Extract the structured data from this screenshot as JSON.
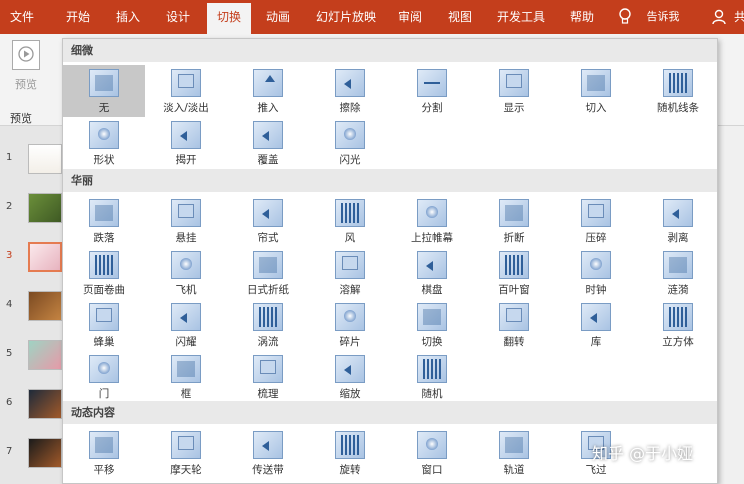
{
  "ribbon": {
    "tabs": [
      "文件",
      "开始",
      "插入",
      "设计",
      "切换",
      "动画",
      "幻灯片放映",
      "审阅",
      "视图",
      "开发工具",
      "帮助",
      "告诉我",
      "共"
    ],
    "active_tab": 4,
    "preview_label": "预览",
    "preview_group_label": "预览"
  },
  "slides": [
    "1",
    "2",
    "3",
    "4",
    "5",
    "6",
    "7"
  ],
  "selected_slide": 2,
  "gallery": {
    "sections": [
      {
        "title": "细微",
        "items": [
          "无",
          "淡入/淡出",
          "推入",
          "擦除",
          "分割",
          "显示",
          "切入",
          "随机线条",
          "形状",
          "揭开",
          "覆盖",
          "闪光"
        ]
      },
      {
        "title": "华丽",
        "items": [
          "跌落",
          "悬挂",
          "帘式",
          "风",
          "上拉帷幕",
          "折断",
          "压碎",
          "剥离",
          "页面卷曲",
          "飞机",
          "日式折纸",
          "溶解",
          "棋盘",
          "百叶窗",
          "时钟",
          "涟漪",
          "蜂巢",
          "闪耀",
          "涡流",
          "碎片",
          "切换",
          "翻转",
          "库",
          "立方体",
          "门",
          "框",
          "梳理",
          "缩放",
          "随机"
        ]
      },
      {
        "title": "动态内容",
        "items": [
          "平移",
          "摩天轮",
          "传送带",
          "旋转",
          "窗口",
          "轨道",
          "飞过"
        ]
      }
    ],
    "selected_item": "无"
  },
  "watermark": "知乎 @于小娅",
  "colors": {
    "accent": "#c43e1c",
    "selection": "#c8c8c8",
    "icon_fill": "#a9c3e3"
  }
}
